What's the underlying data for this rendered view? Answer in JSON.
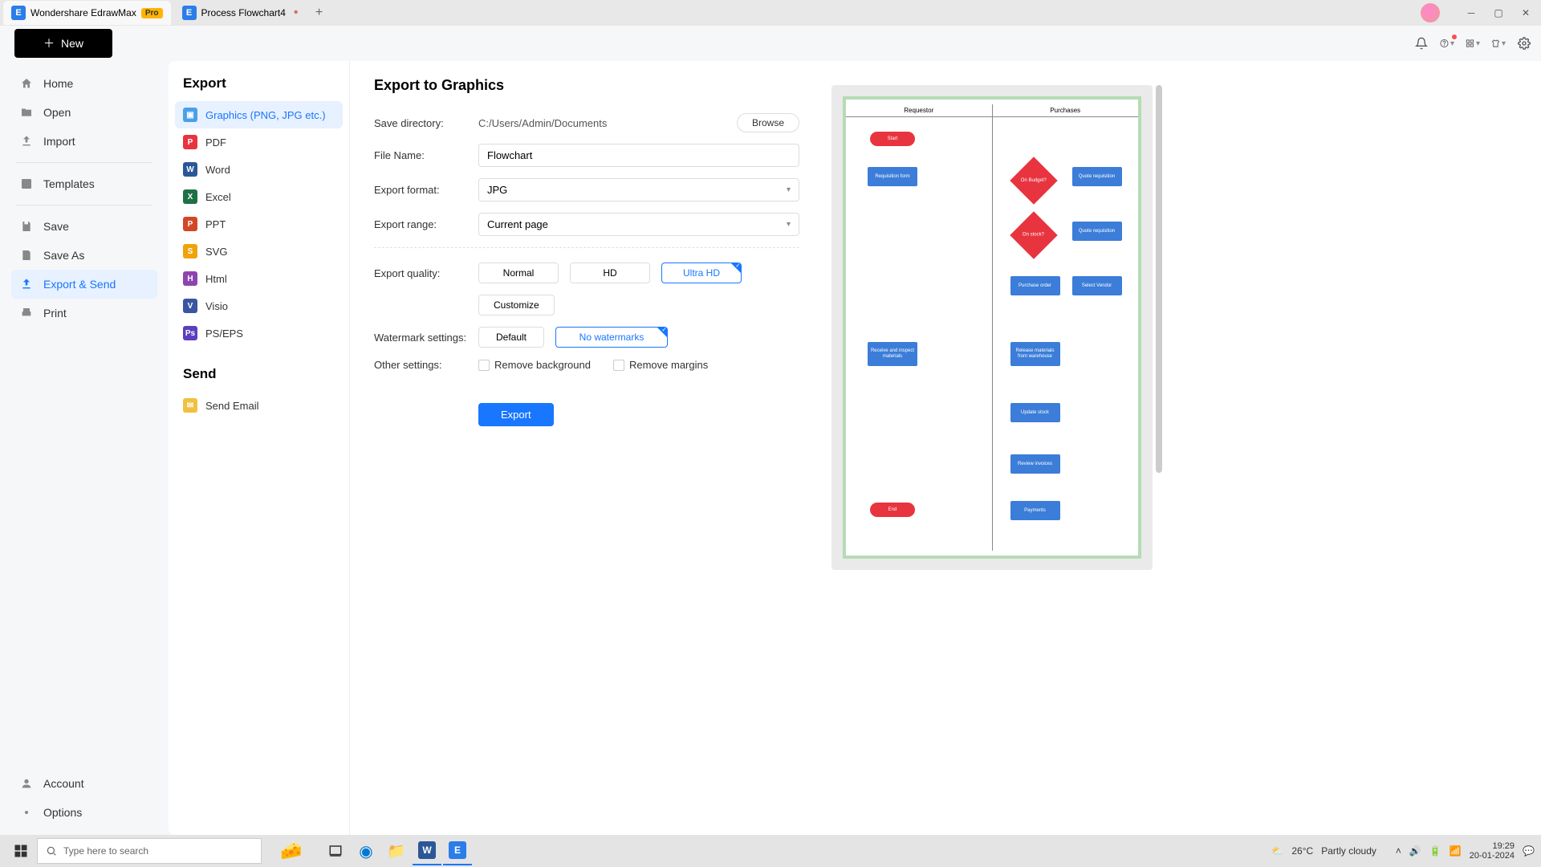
{
  "titlebar": {
    "app_name": "Wondershare EdrawMax",
    "pro_badge": "Pro",
    "file_tab": "Process Flowchart4"
  },
  "toolstrip": {
    "new_label": "New"
  },
  "sidebar": {
    "home": "Home",
    "open": "Open",
    "import": "Import",
    "templates": "Templates",
    "save": "Save",
    "save_as": "Save As",
    "export_send": "Export & Send",
    "print": "Print",
    "account": "Account",
    "options": "Options"
  },
  "export_panel": {
    "export_heading": "Export",
    "send_heading": "Send",
    "items": {
      "graphics": "Graphics (PNG, JPG etc.)",
      "pdf": "PDF",
      "word": "Word",
      "excel": "Excel",
      "ppt": "PPT",
      "svg": "SVG",
      "html": "Html",
      "visio": "Visio",
      "pseps": "PS/EPS",
      "send_email": "Send Email"
    }
  },
  "settings": {
    "title": "Export to Graphics",
    "labels": {
      "save_directory": "Save directory:",
      "file_name": "File Name:",
      "export_format": "Export format:",
      "export_range": "Export range:",
      "export_quality": "Export quality:",
      "watermark": "Watermark settings:",
      "other": "Other settings:"
    },
    "values": {
      "save_directory": "C:/Users/Admin/Documents",
      "file_name": "Flowchart",
      "export_format": "JPG",
      "export_range": "Current page"
    },
    "buttons": {
      "browse": "Browse",
      "customize": "Customize",
      "export": "Export"
    },
    "quality": {
      "normal": "Normal",
      "hd": "HD",
      "ultra": "Ultra HD"
    },
    "watermark": {
      "default": "Default",
      "none": "No watermarks"
    },
    "checkboxes": {
      "remove_bg": "Remove background",
      "remove_margins": "Remove margins"
    }
  },
  "preview": {
    "lane1": "Requestor",
    "lane2": "Purchases",
    "nodes": {
      "start": "Start",
      "req_form": "Requisition form",
      "on_budget": "On Budget?",
      "quote_req1": "Quote requisition",
      "on_stock": "On stock?",
      "quote_req2": "Quote requisition",
      "purchase_order": "Purchase order",
      "select_vendor": "Select Vendor",
      "receive": "Receive and inspect materials",
      "release": "Release materials from warehouse",
      "update": "Update stock",
      "review": "Review invoices",
      "end": "End",
      "payments": "Payments"
    }
  },
  "taskbar": {
    "search_placeholder": "Type here to search",
    "weather_temp": "26°C",
    "weather_desc": "Partly cloudy",
    "time": "19:29",
    "date": "20-01-2024"
  }
}
